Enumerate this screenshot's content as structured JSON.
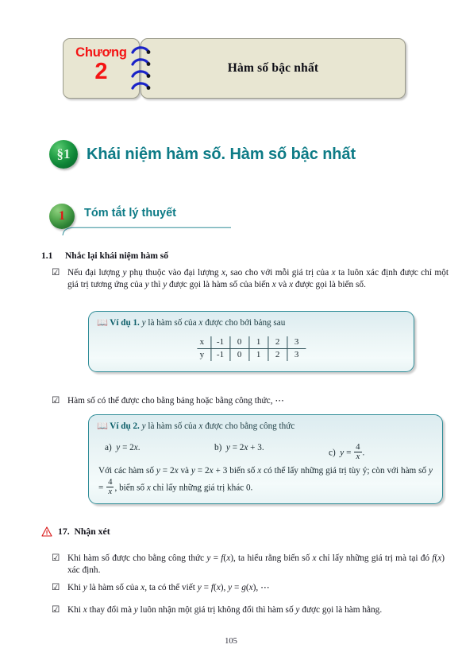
{
  "chapter_banner": {
    "chapter_word": "Chương",
    "chapter_number": "2",
    "title": "Hàm số bậc nhất",
    "plate_color": "#e8e6d2",
    "accent_color": "#f41414",
    "spiral_color": "#1a23c8"
  },
  "section": {
    "badge_label": "§1",
    "title": "Khái niệm hàm số. Hàm số bậc nhất",
    "accent_color": "#0d7b86"
  },
  "topic": {
    "badge_number": "1",
    "title": "Tóm tắt lý thuyết",
    "badge_number_color": "#e01717",
    "accent_color": "#0d7b86"
  },
  "subsection": {
    "number": "1.1",
    "title": "Nhắc lại khái niệm hàm số"
  },
  "bullets": {
    "icon": "checkbox-checked-icon",
    "glyph": "☑",
    "item1_pre": "Nếu đại lượng ",
    "item1": "Nếu đại lượng y phụ thuộc vào đại lượng x, sao cho với mỗi giá trị của x ta luôn xác định được chỉ một giá trị tương ứng của y thì y được gọi là hàm số của biến x và x được gọi là biến số.",
    "item2": "Hàm số có thể được cho bằng bảng hoặc bằng công thức, ⋯"
  },
  "example1": {
    "icon": "book-icon",
    "label": "Ví dụ 1.",
    "text": "y là hàm số của x được cho bởi bảng sau",
    "table": {
      "row_labels": [
        "x",
        "y"
      ],
      "x_values": [
        "-1",
        "0",
        "1",
        "2",
        "3"
      ],
      "y_values": [
        "-1",
        "0",
        "1",
        "2",
        "3"
      ]
    }
  },
  "example2": {
    "icon": "book-icon",
    "label": "Ví dụ 2.",
    "text": "y là hàm số của x được cho bằng công thức",
    "formulas": [
      {
        "tag": "a)",
        "body": "y = 2x."
      },
      {
        "tag": "b)",
        "body": "y = 2x + 3."
      },
      {
        "tag": "c)",
        "body": "y = 4/x."
      }
    ],
    "paragraph": "Với các hàm số y = 2x và y = 2x + 3 biến số x có thể lấy những giá trị tùy ý; còn với hàm số y = 4/x, biến số x chỉ lấy những giá trị khác 0."
  },
  "remark": {
    "icon": "warning-triangle-icon",
    "number": "17.",
    "title": "Nhận xét",
    "accent_color": "#d81414",
    "items": [
      "Khi hàm số được cho bằng công thức y = f(x), ta hiểu rằng biến số x chỉ lấy những giá trị mà tại đó f(x) xác định.",
      "Khi y là hàm số của x, ta có thể viết y = f(x), y = g(x), ⋯",
      "Khi x thay đổi mà y luôn nhận một giá trị không đổi thì hàm số y được gọi là hàm hằng."
    ]
  },
  "footer": {
    "page_number": "105"
  }
}
